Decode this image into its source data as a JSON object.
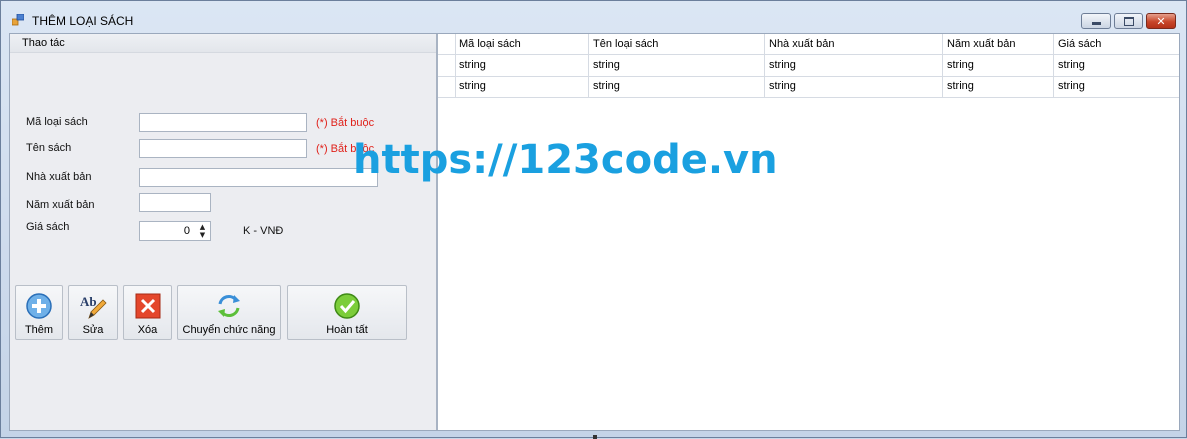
{
  "window": {
    "title": "THÊM LOẠI SÁCH",
    "icon": "app-form-icon",
    "controls": {
      "minimize": "minimize-icon",
      "maximize": "maximize-icon",
      "close": "close-icon",
      "close_glyph": "✕"
    }
  },
  "form": {
    "group_title": "Thao tác",
    "fields": {
      "ma_loai_sach": {
        "label": "Mã loại sách",
        "value": "",
        "required_note": "(*) Bắt buộc"
      },
      "ten_sach": {
        "label": "Tên sách",
        "value": "",
        "required_note": "(*) Bắt buộc"
      },
      "nha_xuat_ban": {
        "label": "Nhà xuất bản",
        "value": ""
      },
      "nam_xuat_ban": {
        "label": "Năm xuất bản",
        "value": ""
      },
      "gia_sach": {
        "label": "Giá sách",
        "value": "0",
        "unit": "K - VNĐ",
        "up": "▲",
        "down": "▼"
      }
    },
    "buttons": {
      "them": {
        "label": "Thêm",
        "icon": "add-icon"
      },
      "sua": {
        "label": "Sửa",
        "icon": "edit-icon",
        "icon_text": "Ab"
      },
      "xoa": {
        "label": "Xóa",
        "icon": "delete-icon"
      },
      "chuyen": {
        "label": "Chuyển chức năng",
        "icon": "switch-icon"
      },
      "hoan_tat": {
        "label": "Hoàn tất",
        "icon": "checkmark-icon"
      }
    }
  },
  "grid": {
    "columns": [
      "Mã loại sách",
      "Tên loại sách",
      "Nhà xuất bản",
      "Năm xuất bản",
      "Giá sách"
    ],
    "rows": [
      [
        "string",
        "string",
        "string",
        "string",
        "string"
      ],
      [
        "string",
        "string",
        "string",
        "string",
        "string"
      ]
    ]
  },
  "watermark": "https://123code.vn",
  "colors": {
    "required": "#e0211a",
    "watermark": "#1aa0e0",
    "close_button": "#c8462a"
  }
}
